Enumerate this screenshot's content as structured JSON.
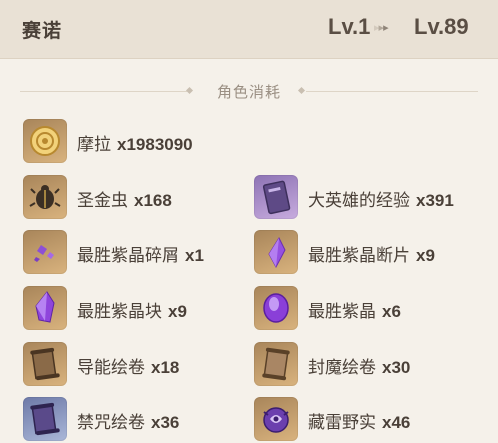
{
  "header": {
    "character_name": "赛诺",
    "level_from": "Lv.1",
    "level_to": "Lv.89",
    "arrow_glyphs": [
      "▸",
      "▸",
      "▸"
    ]
  },
  "section": {
    "title": "角色消耗"
  },
  "materials": [
    {
      "name": "摩拉",
      "qty": "x1983090",
      "icon": "mora-coin-icon",
      "rarity": "gold"
    },
    {
      "name": "圣金虫",
      "qty": "x168",
      "icon": "scarab-icon",
      "rarity": "gold"
    },
    {
      "name": "大英雄的经验",
      "qty": "x391",
      "icon": "exp-book-icon",
      "rarity": "purple"
    },
    {
      "name": "最胜紫晶碎屑",
      "qty": "x1",
      "icon": "amethyst-sliver-icon",
      "rarity": "gold"
    },
    {
      "name": "最胜紫晶断片",
      "qty": "x9",
      "icon": "amethyst-fragment-icon",
      "rarity": "gold"
    },
    {
      "name": "最胜紫晶块",
      "qty": "x9",
      "icon": "amethyst-chunk-icon",
      "rarity": "gold"
    },
    {
      "name": "最胜紫晶",
      "qty": "x6",
      "icon": "amethyst-gemstone-icon",
      "rarity": "gold"
    },
    {
      "name": "导能绘卷",
      "qty": "x18",
      "icon": "scroll-icon",
      "rarity": "gold"
    },
    {
      "name": "封魔绘卷",
      "qty": "x30",
      "icon": "scroll-icon",
      "rarity": "gold"
    },
    {
      "name": "禁咒绘卷",
      "qty": "x36",
      "icon": "forbidden-scroll-icon",
      "rarity": "blue"
    },
    {
      "name": "藏雷野实",
      "qty": "x46",
      "icon": "thunder-fruit-icon",
      "rarity": "gold"
    }
  ]
}
